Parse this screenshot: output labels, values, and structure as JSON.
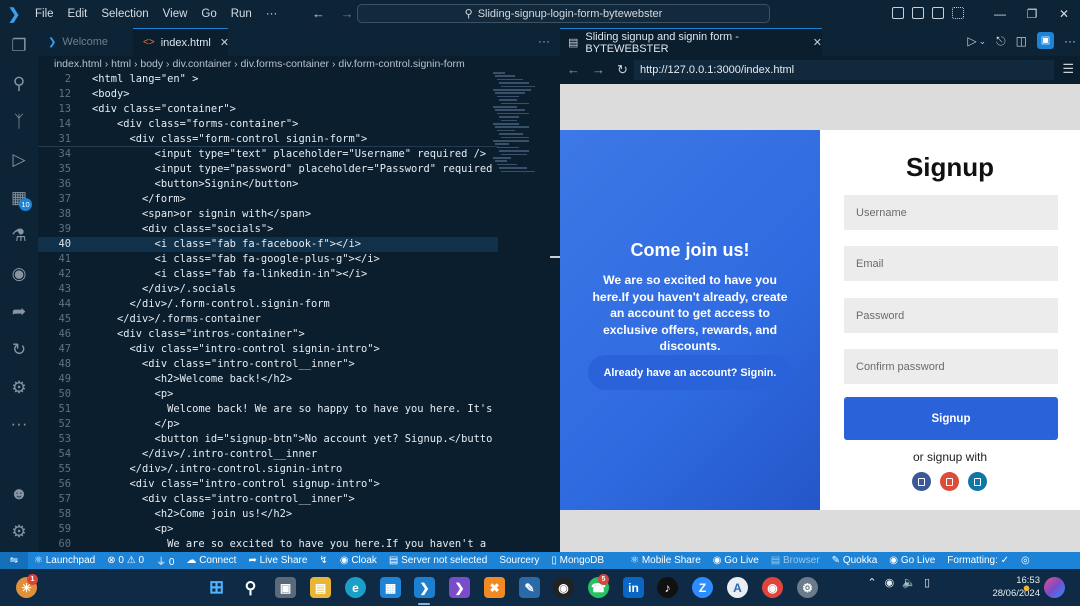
{
  "titlebar": {
    "menu": [
      "File",
      "Edit",
      "Selection",
      "View",
      "Go",
      "Run",
      "···"
    ],
    "command_center": "Sliding-signup-login-form-bytewebster"
  },
  "activitybar": {
    "extensions_badge": "10"
  },
  "editor": {
    "tabs": [
      {
        "label": "Welcome",
        "active": false
      },
      {
        "label": "index.html",
        "active": true
      }
    ],
    "breadcrumb": "index.html  ›  html  ›  body  ›  div.container  ›  div.forms-container  ›  div.form-control.signin-form",
    "lines": [
      {
        "n": "2",
        "t": "<html lang=\"en\" >"
      },
      {
        "n": "12",
        "t": "<body>"
      },
      {
        "n": "13",
        "t": "<div class=\"container\">"
      },
      {
        "n": "14",
        "t": "    <div class=\"forms-container\">"
      },
      {
        "n": "31",
        "t": "      <div class=\"form-control signin-form\">"
      },
      {
        "n": "34",
        "t": "          <input type=\"text\" placeholder=\"Username\" required />"
      },
      {
        "n": "35",
        "t": "          <input type=\"password\" placeholder=\"Password\" required"
      },
      {
        "n": "36",
        "t": "          <button>Signin</button>"
      },
      {
        "n": "37",
        "t": "        </form>"
      },
      {
        "n": "38",
        "t": "        <span>or signin with</span>"
      },
      {
        "n": "39",
        "t": "        <div class=\"socials\">"
      },
      {
        "n": "40",
        "t": "          <i class=\"fab fa-facebook-f\"></i>"
      },
      {
        "n": "41",
        "t": "          <i class=\"fab fa-google-plus-g\"></i>"
      },
      {
        "n": "42",
        "t": "          <i class=\"fab fa-linkedin-in\"></i>"
      },
      {
        "n": "43",
        "t": "        </div>/.socials"
      },
      {
        "n": "44",
        "t": "      </div>/.form-control.signin-form"
      },
      {
        "n": "45",
        "t": "    </div>/.forms-container"
      },
      {
        "n": "46",
        "t": "    <div class=\"intros-container\">"
      },
      {
        "n": "47",
        "t": "      <div class=\"intro-control signin-intro\">"
      },
      {
        "n": "48",
        "t": "        <div class=\"intro-control__inner\">"
      },
      {
        "n": "49",
        "t": "          <h2>Welcome back!</h2>"
      },
      {
        "n": "50",
        "t": "          <p>"
      },
      {
        "n": "51",
        "t": "            Welcome back! We are so happy to have you here. It's"
      },
      {
        "n": "52",
        "t": "          </p>"
      },
      {
        "n": "53",
        "t": "          <button id=\"signup-btn\">No account yet? Signup.</butto"
      },
      {
        "n": "54",
        "t": "        </div>/.intro-control__inner"
      },
      {
        "n": "55",
        "t": "      </div>/.intro-control.signin-intro"
      },
      {
        "n": "56",
        "t": "      <div class=\"intro-control signup-intro\">"
      },
      {
        "n": "57",
        "t": "        <div class=\"intro-control__inner\">"
      },
      {
        "n": "58",
        "t": "          <h2>Come join us!</h2>"
      },
      {
        "n": "59",
        "t": "          <p>"
      },
      {
        "n": "60",
        "t": "            We are so excited to have you here.If you haven't a"
      }
    ],
    "highlighted_line": "40"
  },
  "preview": {
    "tab_label": "Sliding signup and signin form - BYTEWEBSTER",
    "url": "http://127.0.0.1:3000/index.html",
    "intro": {
      "heading": "Come join us!",
      "text": "We are so excited to have you here.If you haven't already, create an account to get access to exclusive offers, rewards, and discounts.",
      "button": "Already have an account? Signin."
    },
    "form": {
      "heading": "Signup",
      "username_placeholder": "Username",
      "email_placeholder": "Email",
      "password_placeholder": "Password",
      "confirm_placeholder": "Confirm password",
      "submit": "Signup",
      "or_text": "or signup with",
      "socials": [
        {
          "name": "facebook",
          "color": "#3b5998"
        },
        {
          "name": "google-plus",
          "color": "#dd4b39"
        },
        {
          "name": "linkedin",
          "color": "#0e76a8"
        }
      ]
    }
  },
  "statusbar": {
    "launchpad": "Launchpad",
    "problems": "⊗ 0 ⚠ 0",
    "ports": "⏚ 0",
    "connect": "Connect",
    "liveshare": "Live Share",
    "cloak": "Cloak",
    "server": "Server not selected",
    "sourcery": "Sourcery",
    "mongodb": "MongoDB",
    "mobile_share": "Mobile Share",
    "go_live_1": "Go Live",
    "browser": "Browser",
    "quokka": "Quokka",
    "go_live_2": "Go Live",
    "formatting": "Formatting: ✓"
  },
  "taskbar": {
    "time": "16:53",
    "date": "28/06/2024",
    "whatsapp_badge": "5",
    "weather_badge": "1"
  },
  "colors": {
    "accent": "#1d83d6",
    "intro_blue": "#2f6be0",
    "form_button": "#2a63d9"
  }
}
